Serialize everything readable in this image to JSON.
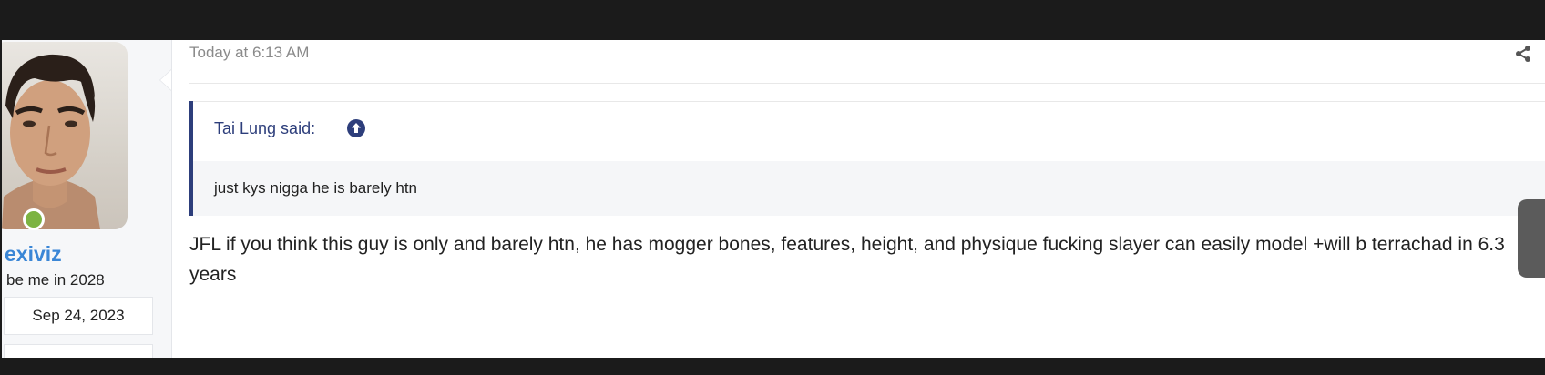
{
  "post": {
    "date": "Today at 6:13 AM",
    "user": {
      "username": "exiviz",
      "title": "be me in 2028",
      "joined": "Sep 24, 2023",
      "status": "online"
    },
    "quote": {
      "author_label": "Tai Lung said:",
      "text": "just kys nigga he is barely htn"
    },
    "message": "JFL if you think this guy is only and barely htn, he has mogger bones, features, height, and physique fucking slayer can easily model +will b terrachad in 6.3 years"
  },
  "icons": {
    "share": "share-icon",
    "quote_jump": "arrow-up-circle-icon"
  },
  "colors": {
    "background_dark": "#1b1b1b",
    "username": "#3a86d6",
    "quote_accent": "#2d3e7b",
    "online": "#7cb342",
    "muted_text": "#8a8a8a"
  }
}
